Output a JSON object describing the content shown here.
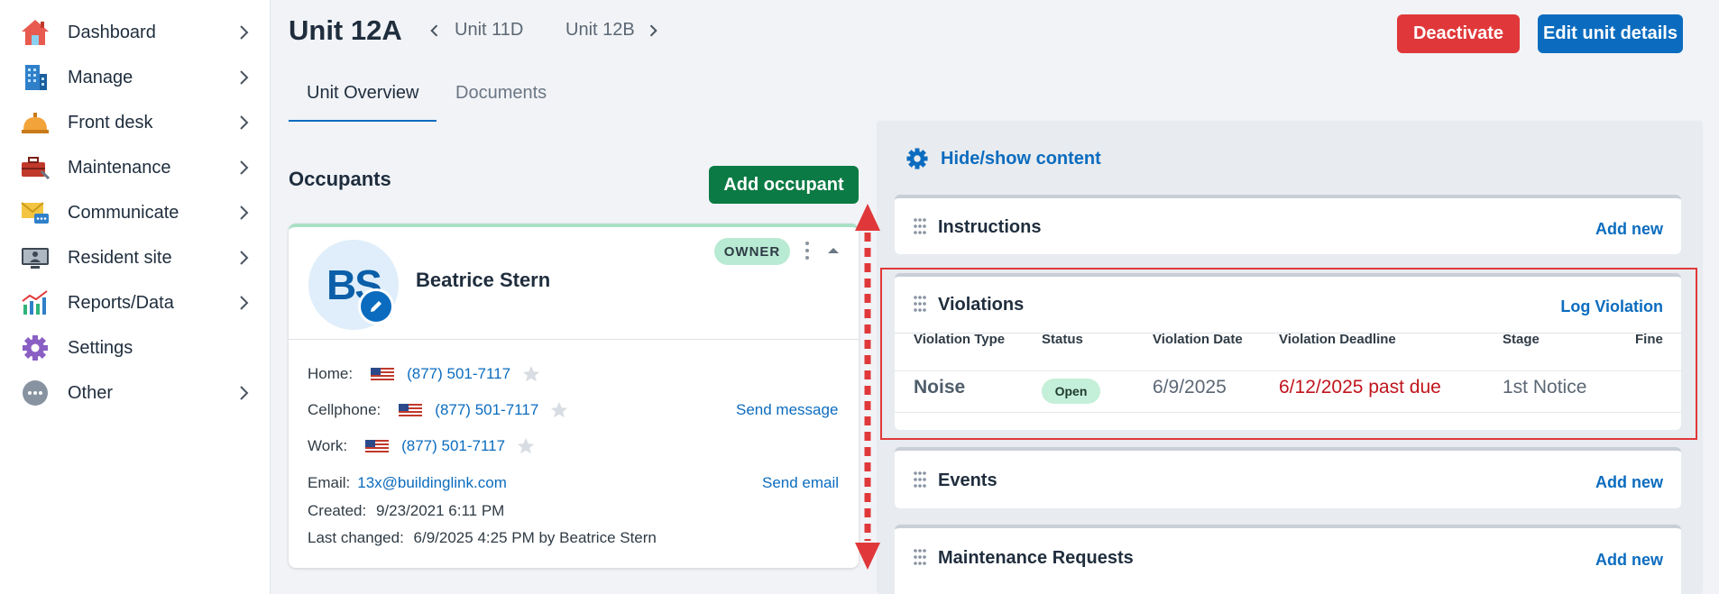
{
  "sidebar": {
    "items": [
      {
        "label": "Dashboard",
        "icon": "home-icon",
        "has_chevron": true
      },
      {
        "label": "Manage",
        "icon": "building-icon",
        "has_chevron": true
      },
      {
        "label": "Front desk",
        "icon": "service-bell-icon",
        "has_chevron": true
      },
      {
        "label": "Maintenance",
        "icon": "toolbox-icon",
        "has_chevron": true
      },
      {
        "label": "Communicate",
        "icon": "mail-chat-icon",
        "has_chevron": true
      },
      {
        "label": "Resident site",
        "icon": "monitor-user-icon",
        "has_chevron": true
      },
      {
        "label": "Reports/Data",
        "icon": "chart-icon",
        "has_chevron": true
      },
      {
        "label": "Settings",
        "icon": "gear-icon",
        "has_chevron": false
      },
      {
        "label": "Other",
        "icon": "more-dots-icon",
        "has_chevron": true
      }
    ]
  },
  "header": {
    "title": "Unit 12A",
    "prev_unit": "Unit 11D",
    "next_unit": "Unit 12B",
    "deactivate_label": "Deactivate",
    "edit_label": "Edit unit details"
  },
  "tabs": [
    {
      "label": "Unit Overview",
      "active": true
    },
    {
      "label": "Documents",
      "active": false
    }
  ],
  "occupants": {
    "title": "Occupants",
    "add_label": "Add occupant",
    "card": {
      "initials": "BS",
      "name": "Beatrice Stern",
      "badge": "OWNER",
      "phones": [
        {
          "label": "Home:",
          "number": "(877) 501-7117"
        },
        {
          "label": "Cellphone:",
          "number": "(877) 501-7117"
        },
        {
          "label": "Work:",
          "number": "(877) 501-7117"
        }
      ],
      "send_message_label": "Send message",
      "email_label": "Email:",
      "email": "13x@buildinglink.com",
      "send_email_label": "Send email",
      "created_label": "Created:",
      "created": "9/23/2021 6:11 PM",
      "changed_label": "Last changed:",
      "changed": "6/9/2025 4:25 PM by Beatrice Stern"
    }
  },
  "right": {
    "hide_show_label": "Hide/show content",
    "sections": {
      "instructions": {
        "title": "Instructions",
        "action": "Add new"
      },
      "violations": {
        "title": "Violations",
        "action": "Log Violation"
      },
      "events": {
        "title": "Events",
        "action": "Add new"
      },
      "maintenance": {
        "title": "Maintenance Requests",
        "action": "Add new"
      }
    },
    "violations_table": {
      "headers": [
        "Violation Type",
        "Status",
        "Violation Date",
        "Violation Deadline",
        "Stage",
        "Fine"
      ],
      "row": {
        "type": "Noise",
        "status": "Open",
        "date": "6/9/2025",
        "deadline": "6/12/2025 past due",
        "stage": "1st Notice",
        "fine": ""
      }
    }
  },
  "colors": {
    "accent_blue": "#0b6cbf",
    "danger_red": "#e0383a",
    "success_green": "#0b7a44",
    "past_due_red": "#c0141c"
  }
}
